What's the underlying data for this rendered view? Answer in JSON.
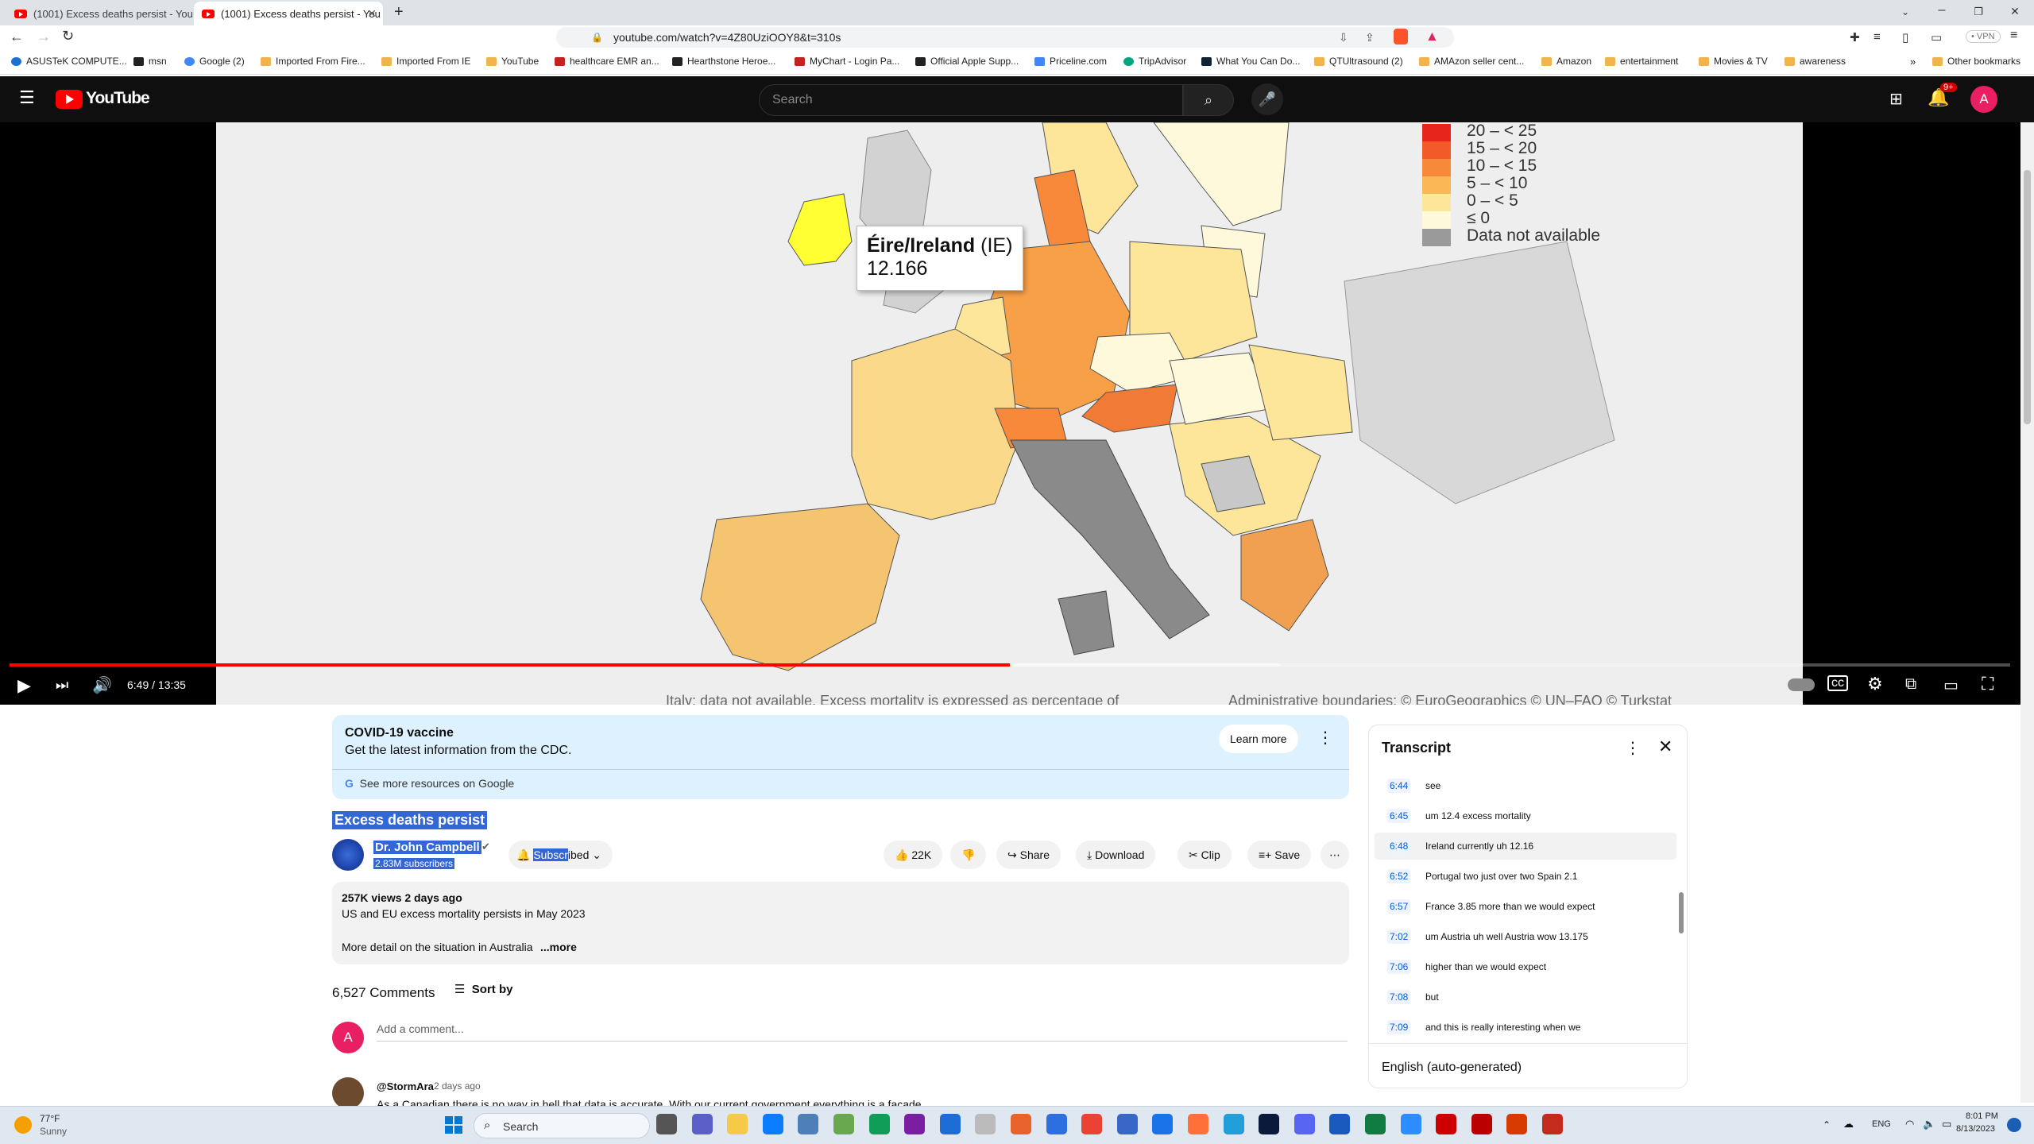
{
  "browser": {
    "tabs": [
      {
        "title": "(1001) Excess deaths persist - YouTub",
        "active": false
      },
      {
        "title": "(1001) Excess deaths persist - You",
        "active": true
      }
    ],
    "url": "youtube.com/watch?v=4Z80UziOOY8&t=310s",
    "vpn_label": "VPN",
    "bookmarks": [
      "ASUSTeK COMPUTE...",
      "msn",
      "Google (2)",
      "Imported From Fire...",
      "Imported From IE",
      "YouTube",
      "healthcare EMR an...",
      "Hearthstone Heroe...",
      "MyChart - Login Pa...",
      "Official Apple Supp...",
      "Priceline.com",
      "TripAdvisor",
      "What You Can Do...",
      "QTUltrasound (2)",
      "AMAzon seller cent...",
      "Amazon",
      "entertainment",
      "Movies & TV",
      "awareness"
    ],
    "other_bookmarks": "Other bookmarks"
  },
  "youtube": {
    "logo": "YouTube",
    "search_placeholder": "Search",
    "notif_count": "9+",
    "avatar_letter": "A"
  },
  "map": {
    "legend": [
      "20 – < 25",
      "15 – < 20",
      "10 – < 15",
      "5 – < 10",
      "0 – < 5",
      "≤ 0",
      "Data not available"
    ],
    "legend_colors": [
      "#e8251c",
      "#f25a2a",
      "#f8883a",
      "#fbb756",
      "#fde59a",
      "#fff9dc",
      "#9a9a9a"
    ],
    "tooltip_country": "Éire/Ireland",
    "tooltip_code": "(IE)",
    "tooltip_value": "12.166",
    "footer_left": "Italy: data not available. Excess mortality is expressed as percentage of",
    "footer_right": "Administrative boundaries: © EuroGeographics © UN–FAO © Turkstat"
  },
  "player": {
    "time": "6:49 / 13:35",
    "progress_fraction": 0.5
  },
  "covid_panel": {
    "title": "COVID-19 vaccine",
    "subtitle": "Get the latest information from the CDC.",
    "learn_more": "Learn more",
    "google_link": "See more resources on Google"
  },
  "video": {
    "title": "Excess deaths persist",
    "channel": "Dr. John Campbell",
    "subscribers": "2.83M subscribers",
    "subscribe_a": "Subscr",
    "subscribe_b": "ibed",
    "likes": "22K",
    "share": "Share",
    "download": "Download",
    "clip": "Clip",
    "save": "Save",
    "views": "257K views  2 days ago",
    "desc_line1": "US and EU excess mortality persists in May 2023",
    "desc_line2": "More detail on the situation in Australia",
    "desc_more": "...more"
  },
  "comments": {
    "count": "6,527 Comments",
    "sort": "Sort by",
    "add_placeholder": "Add a comment...",
    "avatar_letter": "A",
    "first_author": "@StormAra",
    "first_time": "2 days ago",
    "first_text": "As a Canadian there is no way in hell that data is accurate. With our current government everything is a facade"
  },
  "transcript": {
    "title": "Transcript",
    "rows": [
      {
        "time": "6:44",
        "text": "see",
        "active": false
      },
      {
        "time": "6:45",
        "text": "um 12.4 excess mortality",
        "active": false
      },
      {
        "time": "6:48",
        "text": "Ireland currently uh 12.16",
        "active": true
      },
      {
        "time": "6:52",
        "text": "Portugal two just over two Spain 2.1",
        "active": false
      },
      {
        "time": "6:57",
        "text": "France 3.85 more than we would expect",
        "active": false
      },
      {
        "time": "7:02",
        "text": "um Austria uh well Austria wow 13.175",
        "active": false
      },
      {
        "time": "7:06",
        "text": "higher than we would expect",
        "active": false
      },
      {
        "time": "7:08",
        "text": "but",
        "active": false
      },
      {
        "time": "7:09",
        "text": "and this is really interesting when we",
        "active": false
      }
    ],
    "language": "English (auto-generated)"
  },
  "taskbar": {
    "weather_temp": "77°F",
    "weather_desc": "Sunny",
    "search": "Search",
    "lang": "ENG",
    "time": "8:01 PM",
    "date": "8/13/2023"
  }
}
